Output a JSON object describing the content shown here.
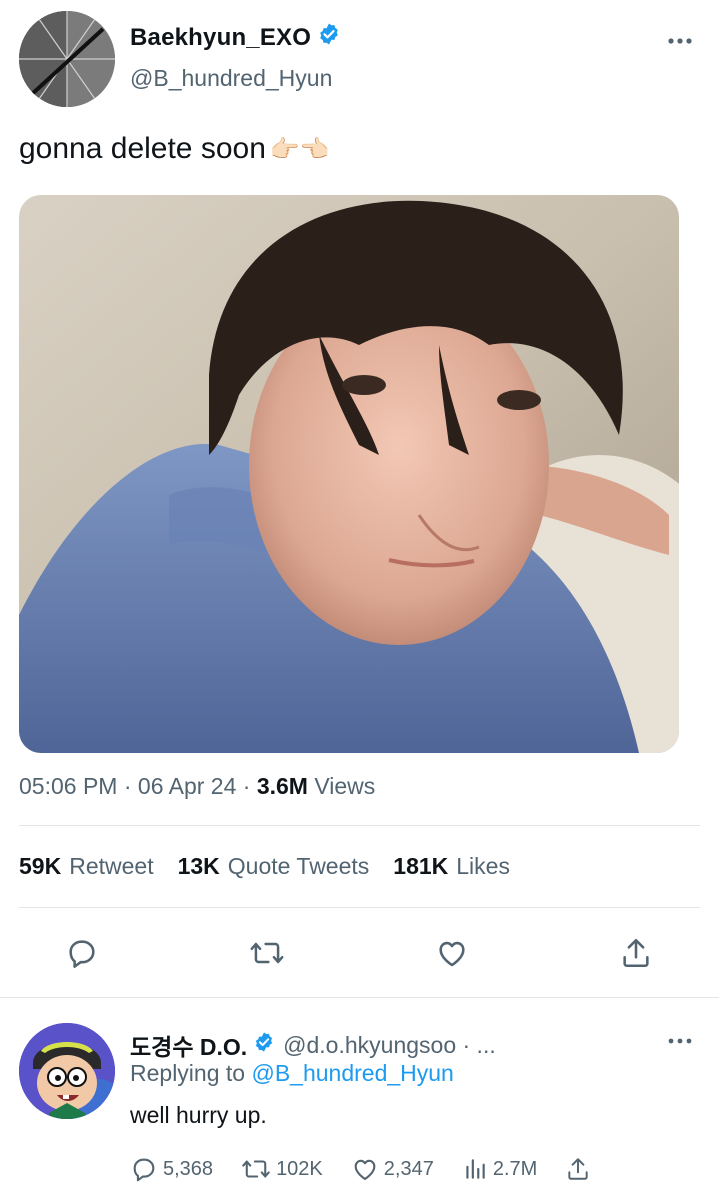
{
  "tweet": {
    "display_name": "Baekhyun_EXO",
    "handle": "@B_hundred_Hyun",
    "text": "gonna delete soon",
    "text_emoji": "👉🏻👈🏻",
    "time": "05:06 PM",
    "dot1": "·",
    "date": "06 Apr 24",
    "dot2": "·",
    "views_count": "3.6M",
    "views_label": "Views",
    "retweets_count": "59K",
    "retweets_label": "Retweet",
    "quotes_count": "13K",
    "quotes_label": "Quote Tweets",
    "likes_count": "181K",
    "likes_label": "Likes",
    "verified": true
  },
  "actions": [
    "reply-icon",
    "retweet-icon",
    "like-icon",
    "share-icon"
  ],
  "reply": {
    "display_name": "도경수 D.O.",
    "handle": "@d.o.hkyungsoo · ...",
    "replying_prefix": "Replying to",
    "replying_to": "@B_hundred_Hyun",
    "text": "well hurry up.",
    "replies": "5,368",
    "retweets": "102K",
    "likes": "2,347",
    "views": "2.7M",
    "more": "..."
  },
  "colors": {
    "accent": "#1d9bf0",
    "secondary_text": "#536471",
    "primary_text": "#0f1419"
  }
}
